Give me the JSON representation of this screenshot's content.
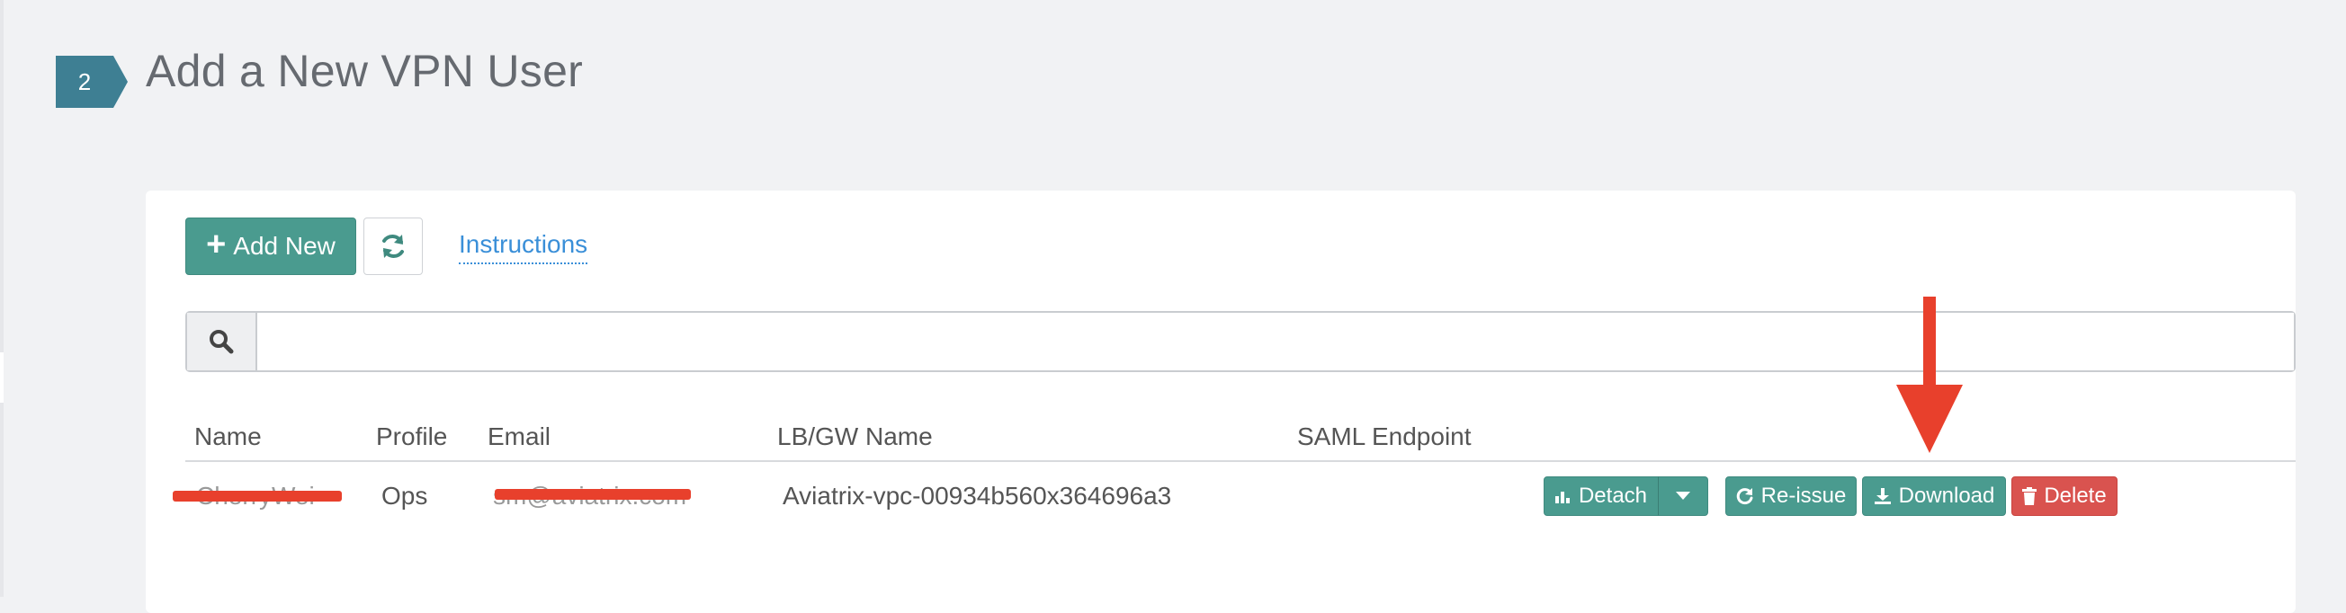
{
  "step": {
    "number": "2"
  },
  "page": {
    "title": "Add a New VPN User"
  },
  "toolbar": {
    "add_new_label": "Add New",
    "instructions_label": "Instructions"
  },
  "search": {
    "value": "",
    "placeholder": ""
  },
  "table": {
    "headers": {
      "name": "Name",
      "profile": "Profile",
      "email": "Email",
      "gateway": "LB/GW Name",
      "saml": "SAML Endpoint"
    },
    "rows": [
      {
        "name": "CherryWei",
        "profile": "Ops",
        "email": "sm@aviatrix.com",
        "gateway": "Aviatrix-vpc-00934b560x364696a3",
        "saml": ""
      }
    ]
  },
  "row_actions": {
    "detach_label": "Detach",
    "reissue_label": "Re-issue",
    "download_label": "Download",
    "delete_label": "Delete"
  },
  "colors": {
    "teal": "#4a9b8f",
    "step_badge": "#3e7f93",
    "danger": "#d9534f",
    "annotation_red": "#e8402c",
    "link": "#3a8fd8"
  },
  "icons": {
    "refresh": "refresh-icon",
    "search": "search-icon",
    "detach": "bar-chart-icon",
    "dropdown": "caret-down-icon",
    "reissue": "redo-icon",
    "download": "download-icon",
    "delete": "trash-icon"
  }
}
